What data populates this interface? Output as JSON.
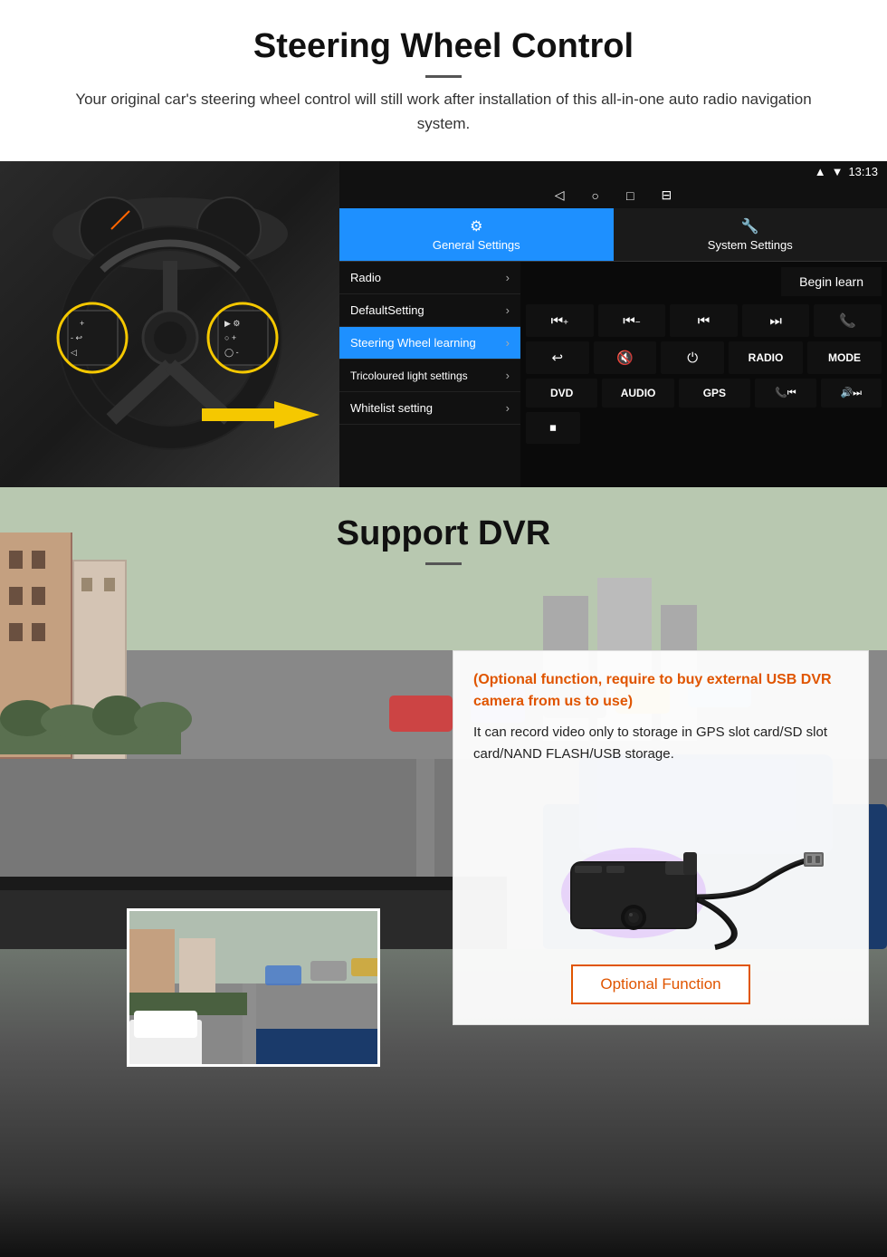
{
  "page": {
    "section1": {
      "title": "Steering Wheel Control",
      "subtitle": "Your original car's steering wheel control will still work after installation of this all-in-one auto radio navigation system.",
      "statusbar": {
        "time": "13:13",
        "wifi_icon": "▼",
        "signal_icon": "▲"
      },
      "navbar": {
        "back": "◁",
        "home": "○",
        "recent": "□",
        "menu": "⊟"
      },
      "tabs": [
        {
          "id": "general",
          "icon": "⚙",
          "label": "General Settings",
          "active": true
        },
        {
          "id": "system",
          "icon": "🔧",
          "label": "System Settings",
          "active": false
        }
      ],
      "menu_items": [
        {
          "label": "Radio",
          "selected": false
        },
        {
          "label": "DefaultSetting",
          "selected": false
        },
        {
          "label": "Steering Wheel learning",
          "selected": true
        },
        {
          "label": "Tricoloured light settings",
          "selected": false
        },
        {
          "label": "Whitelist setting",
          "selected": false
        }
      ],
      "begin_learn": "Begin learn",
      "control_buttons_row1": [
        "⏮+",
        "⏮-",
        "⏮",
        "⏭",
        "📞"
      ],
      "control_buttons_row2": [
        "↩",
        "🔇",
        "⏻",
        "RADIO",
        "MODE"
      ],
      "control_buttons_row3": [
        "DVD",
        "AUDIO",
        "GPS",
        "📞⏮",
        "🔊⏭"
      ],
      "control_buttons_row4": [
        "⏹"
      ]
    },
    "section2": {
      "title": "Support DVR",
      "optional_text": "(Optional function, require to buy external USB DVR camera from us to use)",
      "desc_text": "It can record video only to storage in GPS slot card/SD slot card/NAND FLASH/USB storage.",
      "optional_button": "Optional Function"
    }
  }
}
